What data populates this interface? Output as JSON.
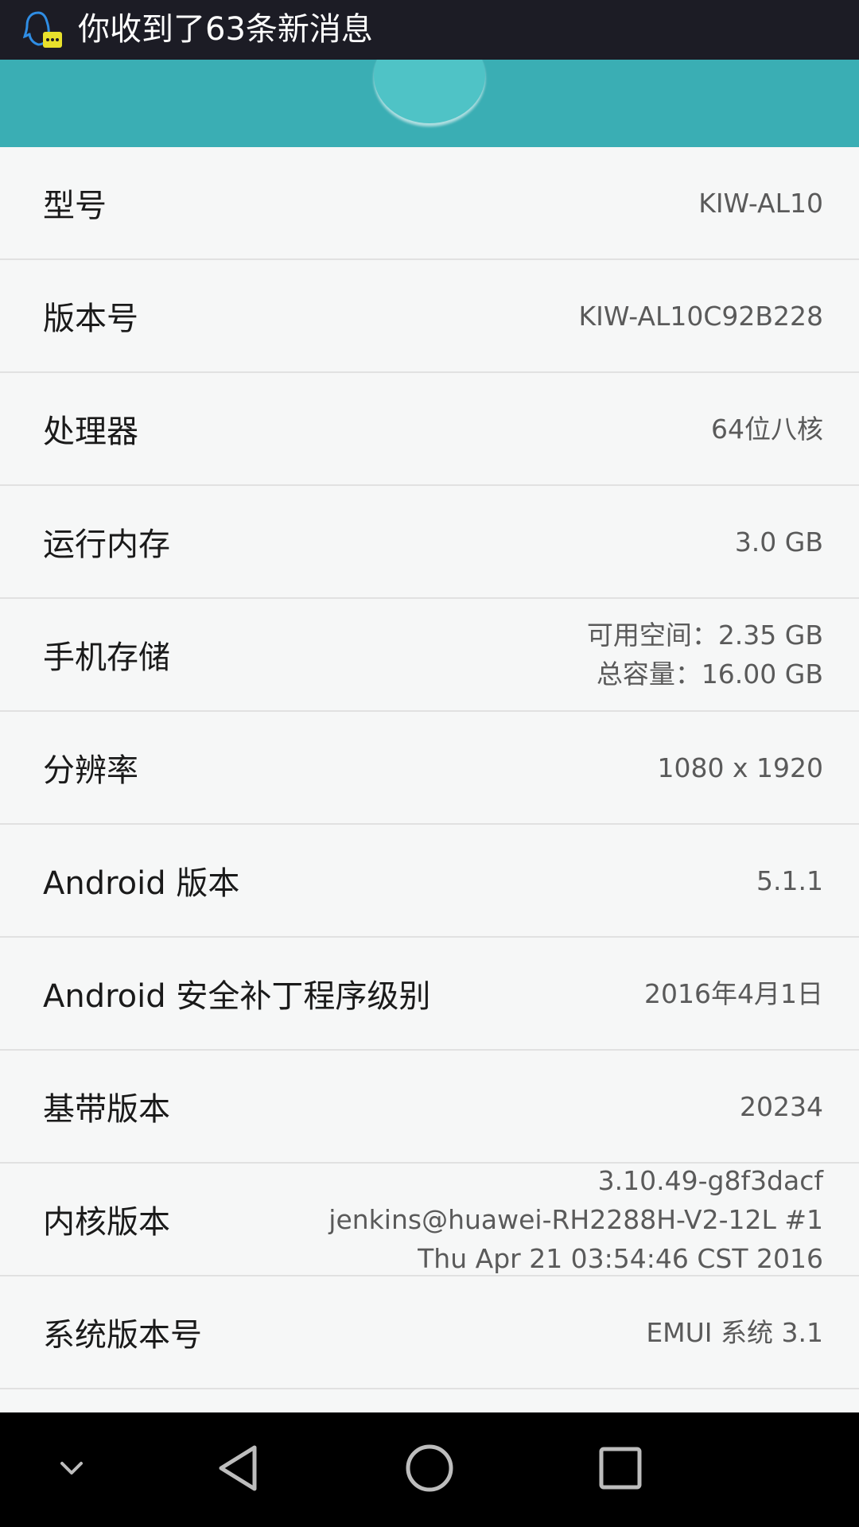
{
  "status_bar": {
    "notification_text": "你收到了63条新消息",
    "notification_icon": "qq-icon"
  },
  "colors": {
    "status_bar_bg": "#1c1c25",
    "header_bg": "#3aaeb4",
    "list_bg": "#f6f7f7",
    "divider": "#e1e1e1",
    "nav_bar_bg": "#000000"
  },
  "info_items": [
    {
      "label": "型号",
      "value": [
        "KIW-AL10"
      ]
    },
    {
      "label": "版本号",
      "value": [
        "KIW-AL10C92B228"
      ]
    },
    {
      "label": "处理器",
      "value": [
        "64位八核"
      ]
    },
    {
      "label": "运行内存",
      "value": [
        "3.0 GB"
      ]
    },
    {
      "label": "手机存储",
      "value": [
        "可用空间：2.35  GB",
        "总容量：16.00  GB"
      ]
    },
    {
      "label": "分辨率",
      "value": [
        "1080 x 1920"
      ]
    },
    {
      "label": "Android 版本",
      "value": [
        "5.1.1"
      ]
    },
    {
      "label": "Android 安全补丁程序级别",
      "value": [
        "2016年4月1日"
      ]
    },
    {
      "label": "基带版本",
      "value": [
        "20234"
      ]
    },
    {
      "label": "内核版本",
      "value": [
        "3.10.49-g8f3dacf",
        "jenkins@huawei-RH2288H-V2-12L #1",
        "Thu Apr 21 03:54:46 CST 2016"
      ]
    },
    {
      "label": "系统版本号",
      "value": [
        "EMUI 系统 3.1"
      ]
    }
  ],
  "nav_bar": {
    "buttons": [
      "chevron-down-icon",
      "back-icon",
      "home-icon",
      "recents-icon"
    ]
  }
}
